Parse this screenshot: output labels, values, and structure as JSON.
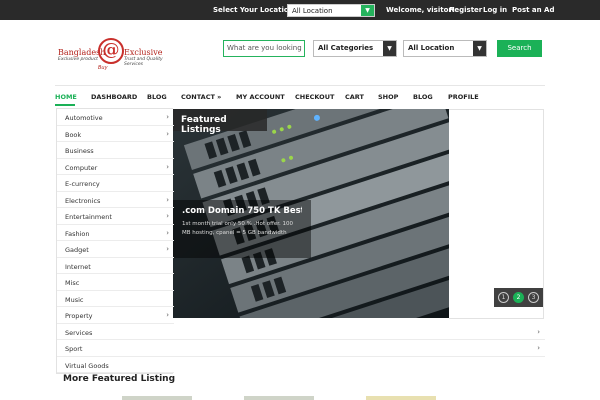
{
  "topbar": {
    "location_label": "Select Your Location",
    "location_value": "All Location",
    "welcome": "Welcome, visitor!",
    "register": "Register",
    "login": "Log in",
    "post_ad": "Post an Ad"
  },
  "logo": {
    "line1": "Bangladesh",
    "line2": "Exclusive product",
    "at": "@",
    "line3": "Exclusive",
    "line4": "Trust and Quality Services",
    "line5": "Buy"
  },
  "search": {
    "placeholder": "What are you looking fo",
    "category": "All Categories",
    "location": "All Location",
    "button": "Search"
  },
  "nav": {
    "items": [
      "HOME",
      "DASHBOARD",
      "BLOG",
      "CONTACT  »",
      "MY ACCOUNT",
      "CHECKOUT",
      "CART",
      "SHOP",
      "BLOG",
      "PROFILE"
    ]
  },
  "categories": [
    {
      "label": "Automotive",
      "chev": "›"
    },
    {
      "label": "Book",
      "chev": "›"
    },
    {
      "label": "Business",
      "chev": ""
    },
    {
      "label": "Computer",
      "chev": "›"
    },
    {
      "label": "E-currency",
      "chev": ""
    },
    {
      "label": "Electronics",
      "chev": "›"
    },
    {
      "label": "Entertainment",
      "chev": "›"
    },
    {
      "label": "Fashion",
      "chev": "›"
    },
    {
      "label": "Gadget",
      "chev": "›"
    },
    {
      "label": "Internet",
      "chev": ""
    },
    {
      "label": "Misc",
      "chev": ""
    },
    {
      "label": "Music",
      "chev": ""
    },
    {
      "label": "Property",
      "chev": "›"
    },
    {
      "label": "Services",
      "chev": "›"
    },
    {
      "label": "Sport",
      "chev": "›"
    },
    {
      "label": "Virtual Goods",
      "chev": ""
    }
  ],
  "slider": {
    "title": "Featured Listings",
    "caption_title": ".com Domain 750 TK Best offe...",
    "caption_desc": "1st month trial only 50 % .Hot offer. 100 MB hosting, cpanel = 5 GB bandwidth",
    "dots": [
      "1",
      "2",
      "3"
    ],
    "active_dot": 2
  },
  "more": {
    "title": "More Featured Listing"
  }
}
